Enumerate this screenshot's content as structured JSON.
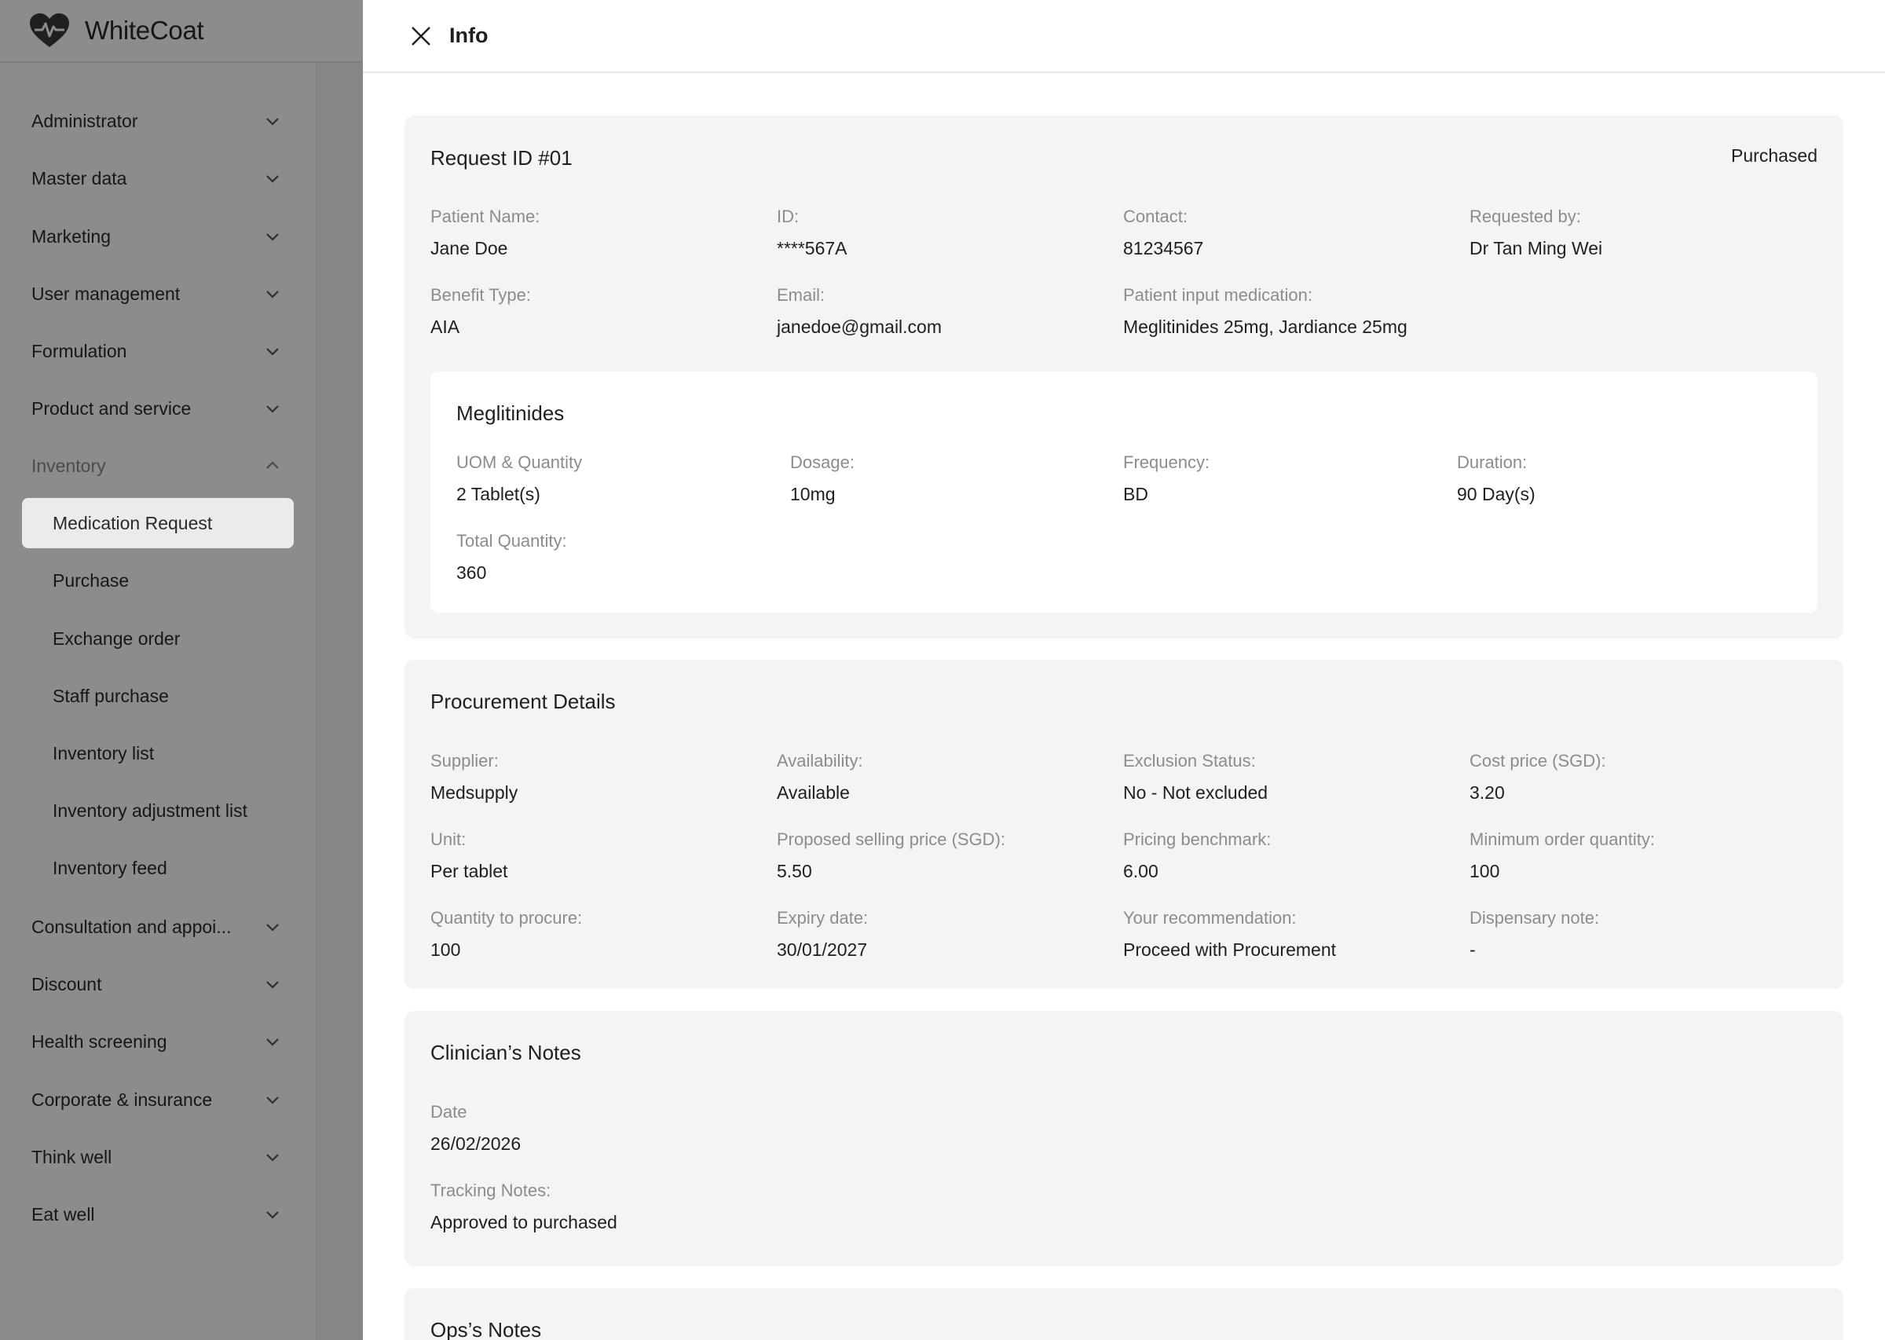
{
  "app": {
    "name": "WhiteCoat"
  },
  "sidebar": {
    "items": [
      {
        "label": "Administrator"
      },
      {
        "label": "Master data"
      },
      {
        "label": "Marketing"
      },
      {
        "label": "User management"
      },
      {
        "label": "Formulation"
      },
      {
        "label": "Product and service"
      },
      {
        "label": "Inventory",
        "expanded": true
      },
      {
        "label": "Consultation and appoi..."
      },
      {
        "label": "Discount"
      },
      {
        "label": "Health screening"
      },
      {
        "label": "Corporate & insurance"
      },
      {
        "label": "Think well"
      },
      {
        "label": "Eat well"
      }
    ],
    "inventory_sub": [
      {
        "label": "Medication Request",
        "active": true
      },
      {
        "label": "Purchase"
      },
      {
        "label": "Exchange order"
      },
      {
        "label": "Staff purchase"
      },
      {
        "label": "Inventory list"
      },
      {
        "label": "Inventory adjustment list"
      },
      {
        "label": "Inventory feed"
      }
    ]
  },
  "drawer": {
    "title": "Info",
    "request": {
      "title": "Request ID #01",
      "status": "Purchased",
      "fields": [
        {
          "label": "Patient Name:",
          "value": "Jane Doe"
        },
        {
          "label": "ID:",
          "value": "****567A"
        },
        {
          "label": "Contact:",
          "value": "81234567"
        },
        {
          "label": "Requested by:",
          "value": "Dr Tan Ming Wei"
        },
        {
          "label": "Benefit Type:",
          "value": "AIA"
        },
        {
          "label": "Email:",
          "value": "janedoe@gmail.com"
        },
        {
          "label": "Patient input medication:",
          "value": "Meglitinides 25mg, Jardiance 25mg"
        }
      ],
      "medication": {
        "title": "Meglitinides",
        "fields": [
          {
            "label": "UOM & Quantity",
            "value": "2 Tablet(s)"
          },
          {
            "label": "Dosage:",
            "value": "10mg"
          },
          {
            "label": "Frequency:",
            "value": "BD"
          },
          {
            "label": "Duration:",
            "value": "90 Day(s)"
          },
          {
            "label": "Total Quantity:",
            "value": "360"
          }
        ]
      }
    },
    "procurement": {
      "title": "Procurement Details",
      "fields": [
        {
          "label": "Supplier:",
          "value": "Medsupply"
        },
        {
          "label": "Availability:",
          "value": "Available"
        },
        {
          "label": "Exclusion Status:",
          "value": "No - Not excluded"
        },
        {
          "label": "Cost price (SGD):",
          "value": "3.20"
        },
        {
          "label": "Unit:",
          "value": "Per tablet"
        },
        {
          "label": "Proposed selling price (SGD):",
          "value": "5.50"
        },
        {
          "label": "Pricing benchmark:",
          "value": "6.00"
        },
        {
          "label": "Minimum order quantity:",
          "value": "100"
        },
        {
          "label": "Quantity to procure:",
          "value": "100"
        },
        {
          "label": "Expiry date:",
          "value": "30/01/2027"
        },
        {
          "label": "Your recommendation:",
          "value": "Proceed with Procurement"
        },
        {
          "label": "Dispensary note:",
          "value": "-"
        }
      ]
    },
    "clinician_notes": {
      "title": "Clinician’s Notes",
      "fields": [
        {
          "label": "Date",
          "value": "26/02/2026"
        },
        {
          "label": "Tracking Notes:",
          "value": "Approved to purchased"
        }
      ]
    },
    "ops_notes": {
      "title": "Ops’s Notes"
    }
  }
}
